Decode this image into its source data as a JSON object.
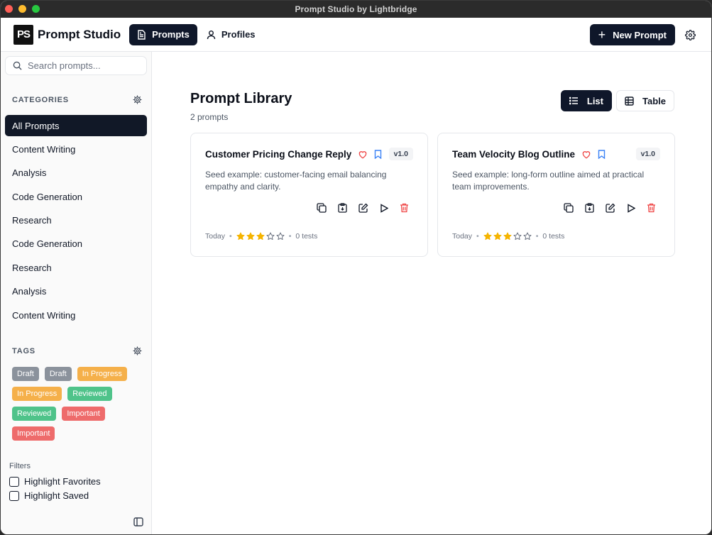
{
  "window": {
    "title": "Prompt Studio by Lightbridge"
  },
  "header": {
    "logo_text": "PS",
    "brand": "Prompt Studio",
    "nav": [
      {
        "label": "Prompts",
        "active": true
      },
      {
        "label": "Profiles",
        "active": false
      }
    ],
    "new_button": "New Prompt"
  },
  "sidebar": {
    "search_placeholder": "Search prompts...",
    "categories_heading": "CATEGORIES",
    "categories": [
      {
        "label": "All Prompts",
        "active": true
      },
      {
        "label": "Content Writing"
      },
      {
        "label": "Analysis"
      },
      {
        "label": "Code Generation"
      },
      {
        "label": "Research"
      },
      {
        "label": "Code Generation"
      },
      {
        "label": "Research"
      },
      {
        "label": "Analysis"
      },
      {
        "label": "Content Writing"
      }
    ],
    "tags_heading": "TAGS",
    "tags": [
      {
        "label": "Draft",
        "color": "#8b929c"
      },
      {
        "label": "Draft",
        "color": "#8b929c"
      },
      {
        "label": "In Progress",
        "color": "#f5b04a"
      },
      {
        "label": "In Progress",
        "color": "#f5b04a"
      },
      {
        "label": "Reviewed",
        "color": "#4fc38a"
      },
      {
        "label": "Reviewed",
        "color": "#4fc38a"
      },
      {
        "label": "Important",
        "color": "#ee6b6b"
      },
      {
        "label": "Important",
        "color": "#ee6b6b"
      }
    ],
    "filters_label": "Filters",
    "filters": [
      {
        "label": "Highlight Favorites",
        "checked": false
      },
      {
        "label": "Highlight Saved",
        "checked": false
      }
    ]
  },
  "main": {
    "title": "Prompt Library",
    "count": "2 prompts",
    "views": [
      {
        "label": "List",
        "active": true
      },
      {
        "label": "Table",
        "active": false
      }
    ],
    "cards": [
      {
        "title": "Customer Pricing Change Reply",
        "version": "v1.0",
        "description": "Seed example: customer-facing email balancing empathy and clarity.",
        "date": "Today",
        "rating": 3,
        "max_rating": 5,
        "tests": "0 tests"
      },
      {
        "title": "Team Velocity Blog Outline",
        "version": "v1.0",
        "description": "Seed example: long-form outline aimed at practical team improvements.",
        "date": "Today",
        "rating": 3,
        "max_rating": 5,
        "tests": "0 tests"
      }
    ]
  },
  "colors": {
    "primary": "#0f172a",
    "heart": "#ef4444",
    "bookmark": "#3b82f6",
    "star": "#f5b400",
    "delete": "#ef4444"
  }
}
